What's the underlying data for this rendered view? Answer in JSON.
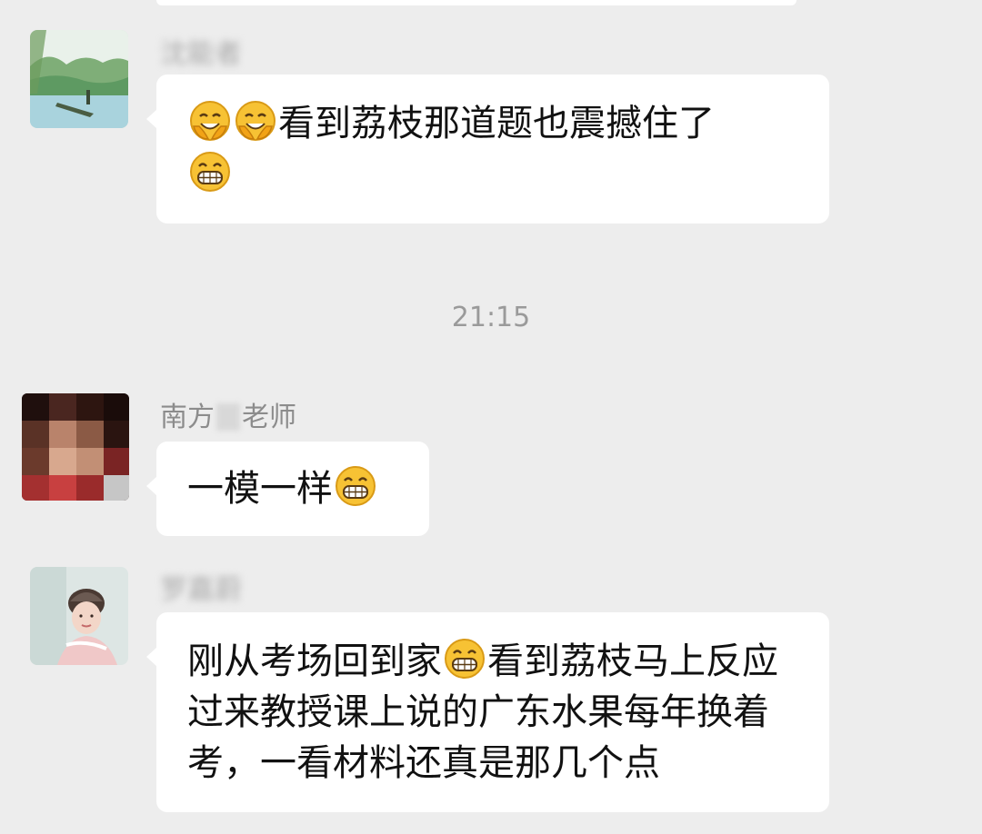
{
  "chat": {
    "timestamp": "21:15",
    "messages": [
      {
        "sender": "沈能者",
        "avatar": "landscape-boat-avatar",
        "segments_1": "看到荔枝那道题也震撼住了",
        "emojis": [
          "shy-grin-emoji",
          "shy-grin-emoji",
          "grin-emoji"
        ]
      },
      {
        "sender_prefix": "南方",
        "sender_suffix": "老师",
        "avatar": "person-photo-avatar",
        "text": "一模一样",
        "emojis": [
          "grin-emoji"
        ]
      },
      {
        "sender": "罗嘉蔚",
        "avatar": "woman-beanie-avatar",
        "text_part1": "刚从考场回到家",
        "text_part2": "看到荔枝马上反应过来教授课上说的广东水果每年换着考，一看材料还真是那几个点",
        "emojis": [
          "grin-emoji"
        ]
      }
    ]
  },
  "colors": {
    "background": "#ededed",
    "bubble": "#ffffff",
    "text": "#111111",
    "name": "#8c8c8c",
    "timestamp": "#9a9a9a"
  }
}
